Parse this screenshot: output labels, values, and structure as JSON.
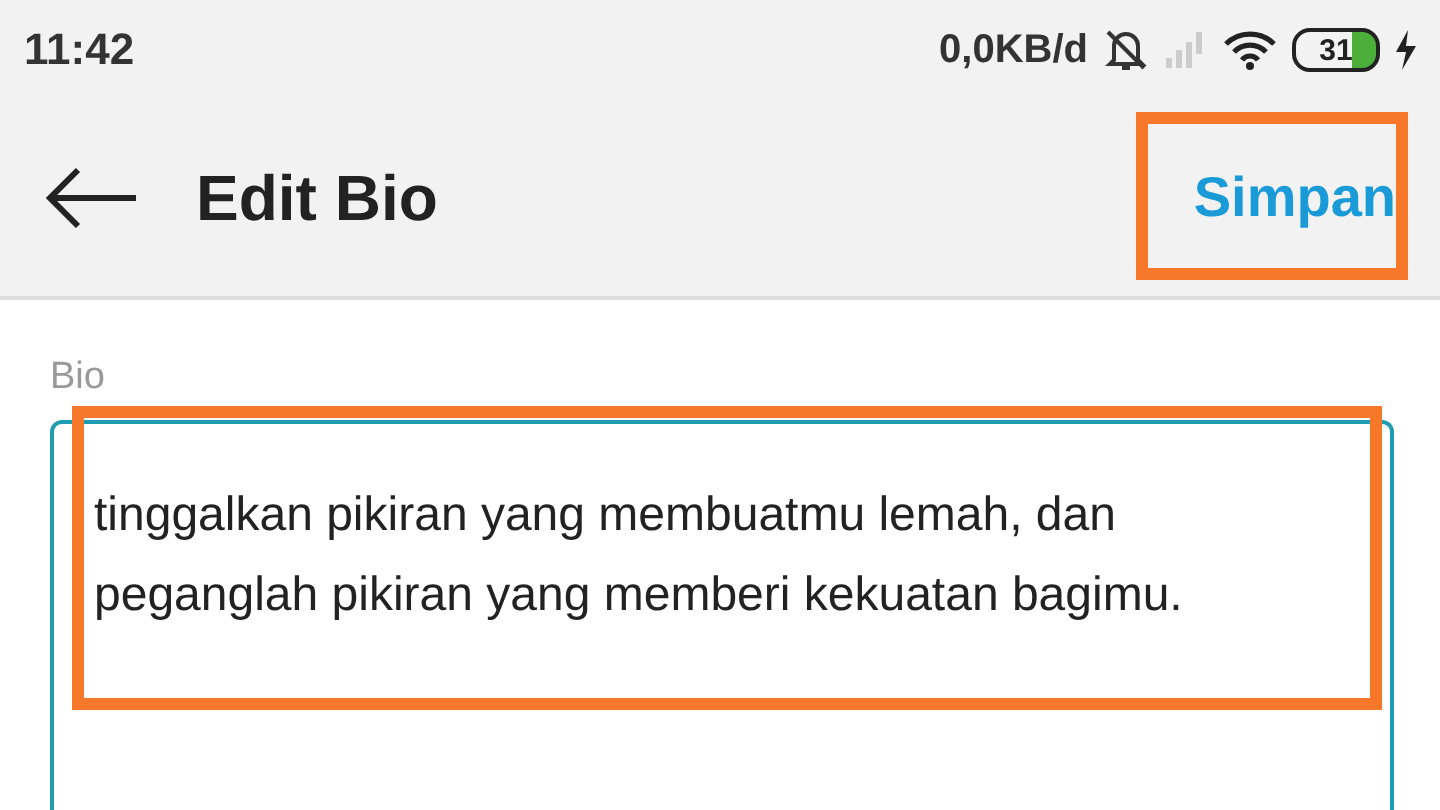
{
  "status_bar": {
    "time": "11:42",
    "net_speed": "0,0KB/d",
    "battery": "31"
  },
  "app_bar": {
    "title": "Edit Bio",
    "save": "Simpan"
  },
  "bio": {
    "label": "Bio",
    "value": "tinggalkan pikiran yang membuatmu lemah, dan peganglah pikiran yang memberi kekuatan bagimu."
  }
}
